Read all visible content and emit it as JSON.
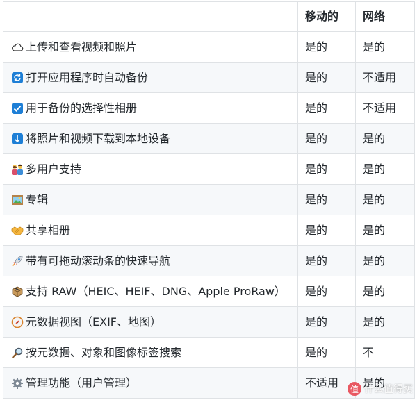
{
  "table": {
    "headers": [
      "",
      "移动的",
      "网络"
    ],
    "rows": [
      {
        "icon": "cloud-icon",
        "feature": "上传和查看视频和照片",
        "mobile": "是的",
        "web": "是的"
      },
      {
        "icon": "sync-arrows-icon",
        "feature": "打开应用程序时自动备份",
        "mobile": "是的",
        "web": "不适用"
      },
      {
        "icon": "checkbox-icon",
        "feature": "用于备份的选择性相册",
        "mobile": "是的",
        "web": "不适用"
      },
      {
        "icon": "down-arrow-icon",
        "feature": "将照片和视频下载到本地设备",
        "mobile": "是的",
        "web": "是的"
      },
      {
        "icon": "couple-icon",
        "feature": "多用户支持",
        "mobile": "是的",
        "web": "是的"
      },
      {
        "icon": "framed-picture-icon",
        "feature": "专辑",
        "mobile": "是的",
        "web": "是的"
      },
      {
        "icon": "handshake-icon",
        "feature": "共享相册",
        "mobile": "是的",
        "web": "是的"
      },
      {
        "icon": "rocket-icon",
        "feature": "带有可拖动滚动条的快速导航",
        "mobile": "是的",
        "web": "是的"
      },
      {
        "icon": "package-icon",
        "feature": "支持 RAW（HEIC、HEIF、DNG、Apple ProRaw）",
        "mobile": "是的",
        "web": "是的"
      },
      {
        "icon": "compass-icon",
        "feature": "元数据视图（EXIF、地图）",
        "mobile": "是的",
        "web": "是的"
      },
      {
        "icon": "magnifier-icon",
        "feature": "按元数据、对象和图像标签搜索",
        "mobile": "是的",
        "web": "不"
      },
      {
        "icon": "gear-icon",
        "feature": "管理功能（用户管理）",
        "mobile": "不适用",
        "web": "是的"
      }
    ]
  },
  "watermark": {
    "badge": "值",
    "text": "什么值得买"
  }
}
